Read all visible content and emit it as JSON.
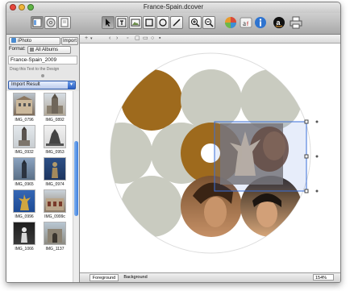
{
  "window": {
    "title": "France-Spain.dcover"
  },
  "colors": {
    "accent": "#3d7fde",
    "disc_circle": "#c9cbc0",
    "disc_brown": "#9e6a1d",
    "selection": "#3a6fd8"
  },
  "toolbar": {
    "icons": [
      "show-library-icon",
      "cd-icon",
      "print-preview-icon",
      "arrow-pointer-icon",
      "text-tool-icon",
      "image-tool-icon",
      "rectangle-tool-icon",
      "ellipse-tool-icon",
      "line-tool-icon",
      "zoom-in-icon",
      "zoom-out-icon",
      "color-icon",
      "font-icon",
      "info-icon",
      "amazon-icon",
      "print-icon"
    ]
  },
  "sidebar": {
    "source": "iPhoto",
    "import_label": "Import",
    "format_label": "Format:",
    "format_value": "All Albums",
    "album_name": "France-Spain_2009",
    "hint": "Drag this Text to the Design",
    "result_label": "Import Result",
    "photos": [
      {
        "caption": "IMG_0796",
        "icon": "building-photo"
      },
      {
        "caption": "IMG_0892",
        "icon": "church-photo"
      },
      {
        "caption": "IMG_0932",
        "icon": "tower-photo"
      },
      {
        "caption": "IMG_0953",
        "icon": "monument-photo"
      },
      {
        "caption": "IMG_0965",
        "icon": "tower-night-photo"
      },
      {
        "caption": "IMG_0974",
        "icon": "statue-photo"
      },
      {
        "caption": "IMG_0996",
        "icon": "golden-statue-photo"
      },
      {
        "caption": "IMG_0999c",
        "icon": "street-photo"
      },
      {
        "caption": "IMG_1066",
        "icon": "sculpture-photo"
      },
      {
        "caption": "IMG_1137",
        "icon": "gate-photo"
      }
    ]
  },
  "canvas": {
    "tabs": [
      "Foreground",
      "Background"
    ],
    "zoom": "154%"
  }
}
